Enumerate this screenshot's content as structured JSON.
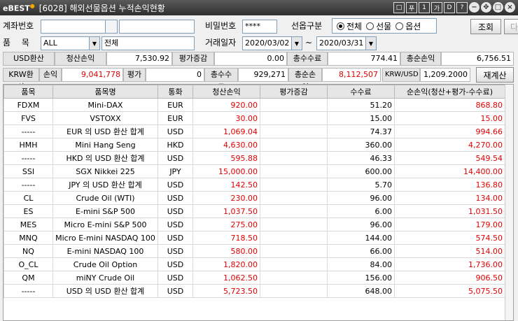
{
  "window": {
    "logo": "BEST",
    "title": "[6028] 해외선물옵션 누적손익현황",
    "controls": [
      "□",
      "푸",
      "1",
      "가",
      "D",
      "?"
    ]
  },
  "filters": {
    "account_label": "계좌번호",
    "password_label": "비밀번호",
    "password_value": "****",
    "option_label": "선옵구분",
    "radios": [
      {
        "label": "전체",
        "selected": true
      },
      {
        "label": "선물",
        "selected": false
      },
      {
        "label": "옵션",
        "selected": false
      }
    ],
    "query_button": "조회",
    "next_button": "다음",
    "item_label": "품 목",
    "item_value": "ALL",
    "item_name": "전체",
    "trade_date_label": "거래일자",
    "date_from": "2020/03/02",
    "date_sep": "~",
    "date_to": "2020/03/31"
  },
  "usd_summary": {
    "label": "USD환산",
    "f1_label": "청산손익",
    "f1_value": "7,530.92",
    "f2_label": "평가증감",
    "f2_value": "0.00",
    "f3_label": "총수수료",
    "f3_value": "774.41",
    "f4_label": "총순손익",
    "f4_value": "6,756.51"
  },
  "krw_summary": {
    "label": "KRW환산",
    "f1_label": "손익",
    "f1_value": "9,041,778",
    "f2_label": "평가",
    "f2_value": "0",
    "f3_label": "총수수료",
    "f3_value": "929,271",
    "f4_label": "총순손익",
    "f4_value": "8,112,507",
    "rate_label": "KRW/USD",
    "rate_value": "1,209.2000",
    "recalc_button": "재계산"
  },
  "table": {
    "headers": [
      "품목",
      "품목명",
      "통화",
      "청산손익",
      "평가증감",
      "수수료",
      "순손익(청산+평가-수수료)"
    ],
    "rows": [
      [
        "FDXM",
        "Mini-DAX",
        "EUR",
        "920.00",
        "",
        "51.20",
        "868.80"
      ],
      [
        "FVS",
        "VSTOXX",
        "EUR",
        "30.00",
        "",
        "15.00",
        "15.00"
      ],
      [
        "-----",
        "EUR 의 USD 환산 합계",
        "USD",
        "1,069.04",
        "",
        "74.37",
        "994.66"
      ],
      [
        "HMH",
        "Mini Hang Seng",
        "HKD",
        "4,630.00",
        "",
        "360.00",
        "4,270.00"
      ],
      [
        "-----",
        "HKD 의 USD 환산 합계",
        "USD",
        "595.88",
        "",
        "46.33",
        "549.54"
      ],
      [
        "SSI",
        "SGX Nikkei 225",
        "JPY",
        "15,000.00",
        "",
        "600.00",
        "14,400.00"
      ],
      [
        "-----",
        "JPY 의 USD 환산 합계",
        "USD",
        "142.50",
        "",
        "5.70",
        "136.80"
      ],
      [
        "CL",
        "Crude Oil (WTI)",
        "USD",
        "230.00",
        "",
        "96.00",
        "134.00"
      ],
      [
        "ES",
        "E-mini S&P 500",
        "USD",
        "1,037.50",
        "",
        "6.00",
        "1,031.50"
      ],
      [
        "MES",
        "Micro E-mini S&P 500",
        "USD",
        "275.00",
        "",
        "96.00",
        "179.00"
      ],
      [
        "MNQ",
        "Micro E-mini NASDAQ 100",
        "USD",
        "718.50",
        "",
        "144.00",
        "574.50"
      ],
      [
        "NQ",
        "E-mini NASDAQ 100",
        "USD",
        "580.00",
        "",
        "66.00",
        "514.00"
      ],
      [
        "O_CL",
        "Crude Oil Option",
        "USD",
        "1,820.00",
        "",
        "84.00",
        "1,736.00"
      ],
      [
        "QM",
        "miNY Crude Oil",
        "USD",
        "1,062.50",
        "",
        "156.00",
        "906.50"
      ],
      [
        "-----",
        "USD 의 USD 환산 합계",
        "USD",
        "5,723.50",
        "",
        "648.00",
        "5,075.50"
      ]
    ]
  }
}
